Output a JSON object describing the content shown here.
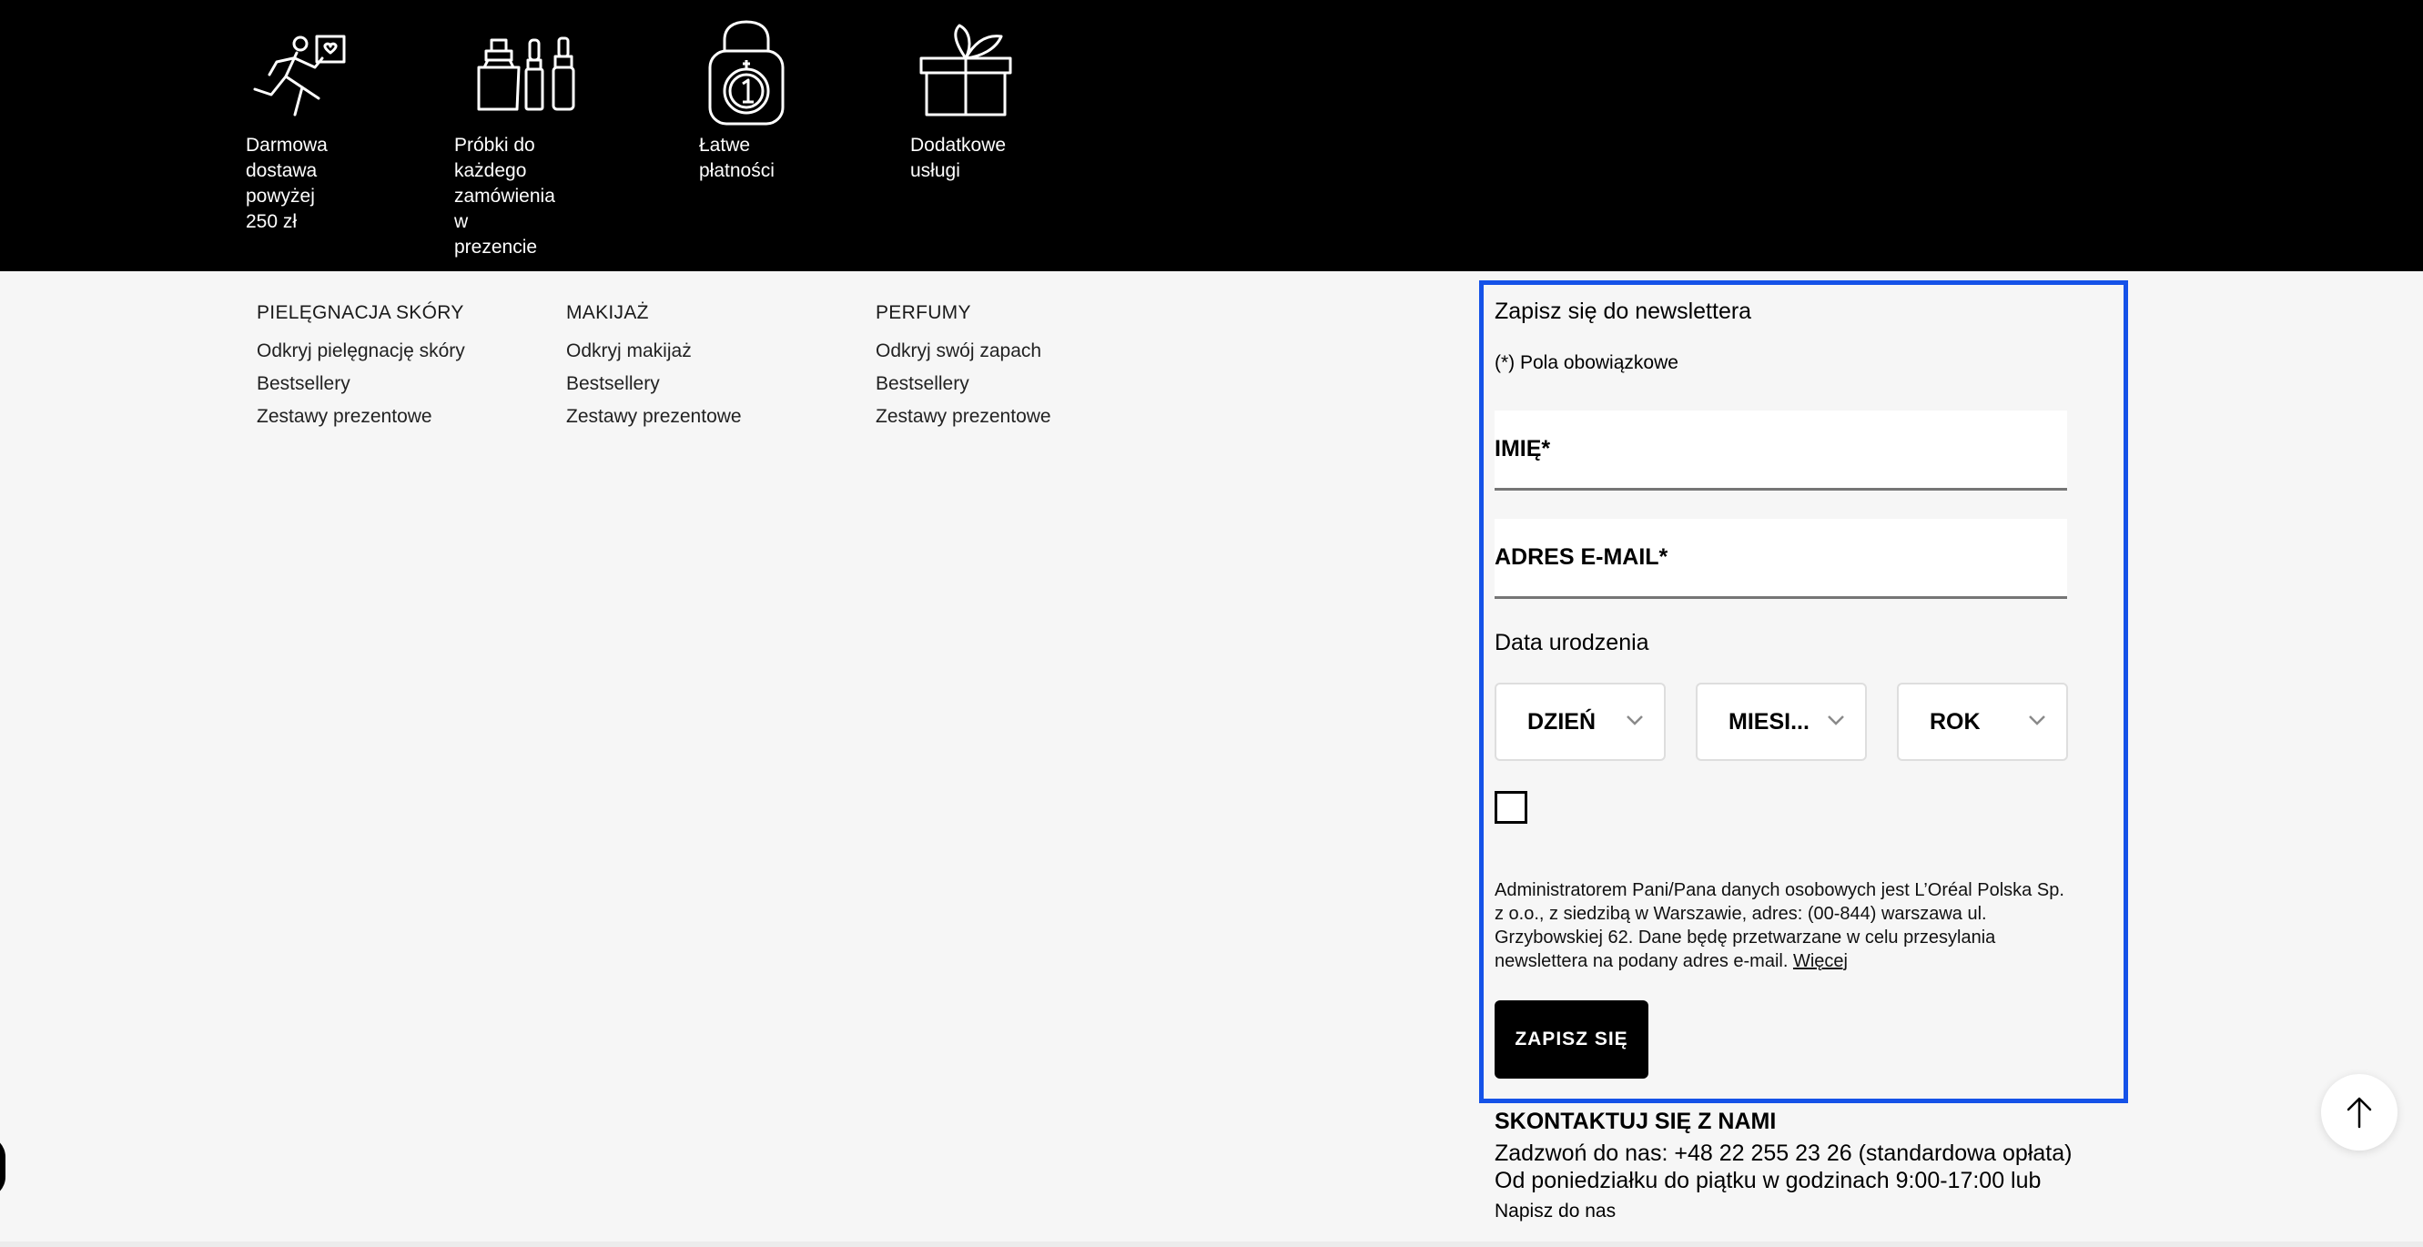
{
  "services": [
    {
      "icon": "delivery-runner-icon",
      "label": "Darmowa dostawa\npowyżej 250 zł"
    },
    {
      "icon": "cosmetics-samples-icon",
      "label": "Próbki do każdego\nzamówienia\nw prezencie"
    },
    {
      "icon": "secure-payment-lock-icon",
      "label": "Łatwe płatności"
    },
    {
      "icon": "gift-box-icon",
      "label": "Dodatkowe usługi"
    }
  ],
  "footer_columns": [
    {
      "heading": "PIELĘGNACJA SKÓRY",
      "links": [
        "Odkryj pielęgnację skóry",
        "Bestsellery",
        "Zestawy prezentowe"
      ]
    },
    {
      "heading": "MAKIJAŻ",
      "links": [
        "Odkryj makijaż",
        "Bestsellery",
        "Zestawy prezentowe"
      ]
    },
    {
      "heading": "PERFUMY",
      "links": [
        "Odkryj swój zapach",
        "Bestsellery",
        "Zestawy prezentowe"
      ]
    }
  ],
  "newsletter": {
    "title": "Zapisz się do newslettera",
    "required_note": "(*) Pola obowiązkowe",
    "name_label": "IMIĘ*",
    "email_label": "ADRES E-MAIL*",
    "dob_label": "Data urodzenia",
    "day_select": "DZIEŃ",
    "month_select": "MIESI...",
    "year_select": "ROK",
    "legal_text": "Administratorem Pani/Pana danych osobowych jest L’Oréal Polska Sp. z o.o., z siedzibą w Warszawie, adres: (00-844) warszawa ul. Grzybowskiej 62. Dane będę przetwarzane w celu przesylania newslettera na podany adres e-mail.",
    "more_link": "Więcej",
    "submit_label": "ZAPISZ SIĘ",
    "highlight_color": "#1552e8"
  },
  "contact": {
    "title": "SKONTAKTUJ SIĘ Z NAMI",
    "phone_line": "Zadzwoń do nas: +48 22 255 23 26 (standardowa opłata)",
    "hours_line": "Od poniedziałku do piątku w godzinach 9:00-17:00 lub",
    "write_link": "Napisz do nas"
  },
  "scroll_top_icon": "arrow-up-icon"
}
